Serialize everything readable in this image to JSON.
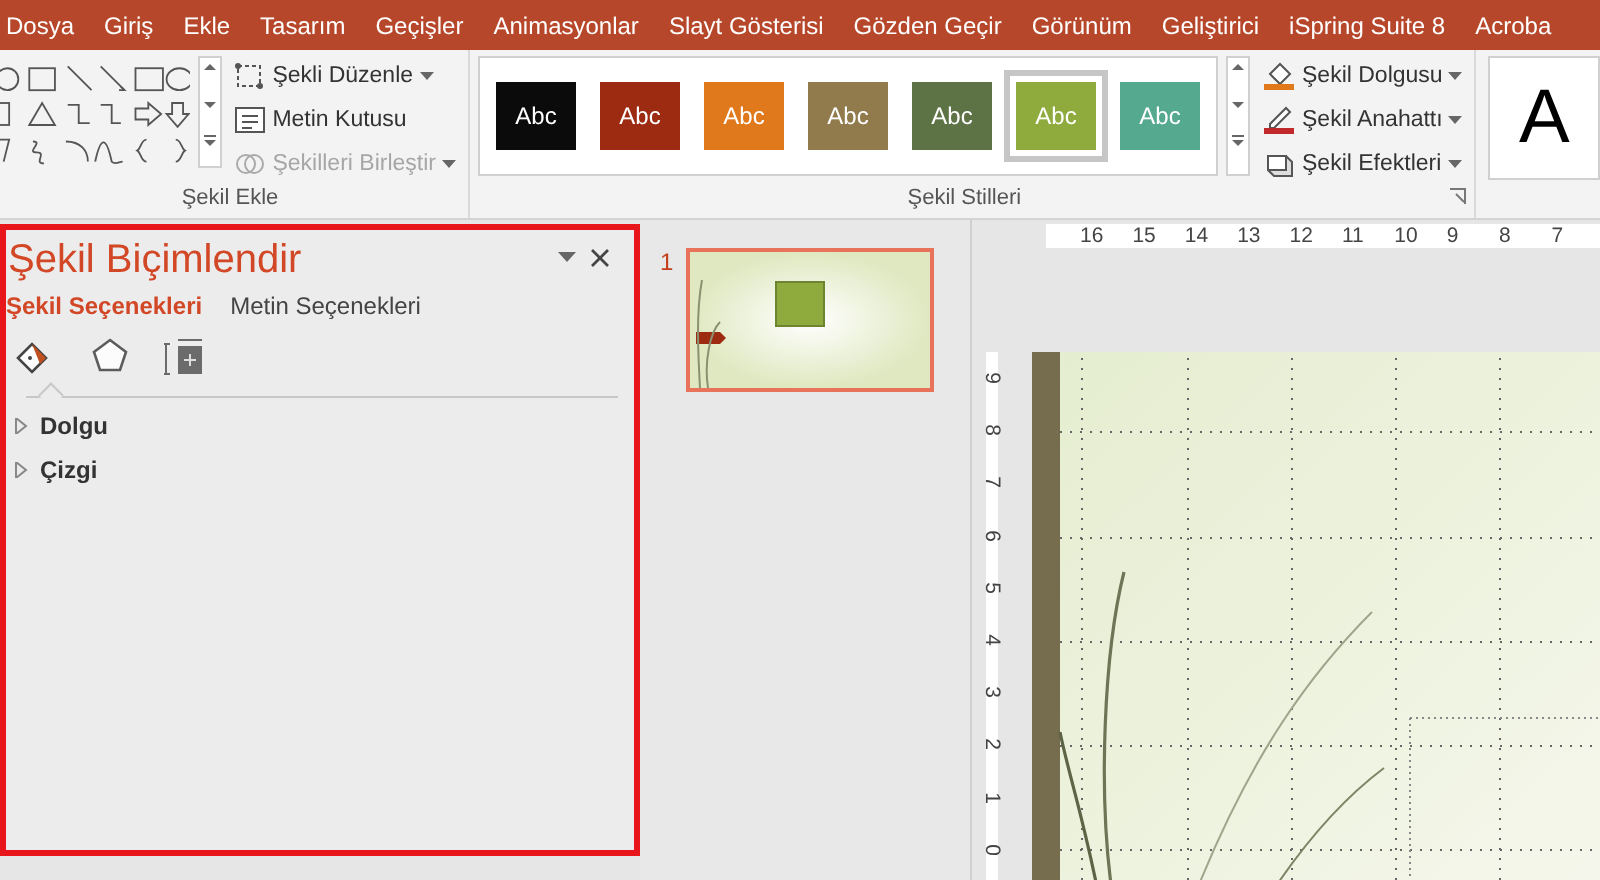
{
  "ribbon_tabs": [
    {
      "label": "Dosya"
    },
    {
      "label": "Giriş"
    },
    {
      "label": "Ekle"
    },
    {
      "label": "Tasarım"
    },
    {
      "label": "Geçişler"
    },
    {
      "label": "Animasyonlar"
    },
    {
      "label": "Slayt Gösterisi"
    },
    {
      "label": "Gözden Geçir"
    },
    {
      "label": "Görünüm"
    },
    {
      "label": "Geliştirici"
    },
    {
      "label": "iSpring Suite 8"
    },
    {
      "label": "Acroba"
    }
  ],
  "ribbon": {
    "insert_shapes": {
      "label": "Şekil Ekle",
      "commands": [
        {
          "kind": "edit",
          "label": "Şekli Düzenle",
          "dropdown": true,
          "disabled": false
        },
        {
          "kind": "textbox",
          "label": "Metin Kutusu",
          "dropdown": false,
          "disabled": false
        },
        {
          "kind": "merge",
          "label": "Şekilleri Birleştir",
          "dropdown": true,
          "disabled": true
        }
      ]
    },
    "shape_styles": {
      "label": "Şekil Stilleri",
      "styles": [
        {
          "label": "Abc",
          "color": "#0b0b0b",
          "selected": false
        },
        {
          "label": "Abc",
          "color": "#9c2b12",
          "selected": false
        },
        {
          "label": "Abc",
          "color": "#e0781c",
          "selected": false
        },
        {
          "label": "Abc",
          "color": "#917b4c",
          "selected": false
        },
        {
          "label": "Abc",
          "color": "#5e7345",
          "selected": false
        },
        {
          "label": "Abc",
          "color": "#90ab3d",
          "selected": true
        },
        {
          "label": "Abc",
          "color": "#55a98f",
          "selected": false
        }
      ],
      "commands": [
        {
          "kind": "fill",
          "label": "Şekil Dolgusu"
        },
        {
          "kind": "outline",
          "label": "Şekil Anahattı"
        },
        {
          "kind": "effects",
          "label": "Şekil Efektleri"
        }
      ]
    },
    "wordart": {
      "label": "A"
    }
  },
  "format_pane": {
    "title": "Şekil Biçimlendir",
    "tabs": [
      {
        "label": "Şekil Seçenekleri",
        "selected": true
      },
      {
        "label": "Metin Seçenekleri",
        "selected": false
      }
    ],
    "icon_tabs": [
      {
        "kind": "fill",
        "selected": true
      },
      {
        "kind": "shape",
        "selected": false
      },
      {
        "kind": "size",
        "selected": false
      }
    ],
    "sections": [
      {
        "label": "Dolgu",
        "expanded": false
      },
      {
        "label": "Çizgi",
        "expanded": false
      }
    ]
  },
  "slides": [
    {
      "number": "1",
      "selected": true
    }
  ],
  "rulers": {
    "horizontal": [
      "16",
      "15",
      "14",
      "13",
      "12",
      "11",
      "10",
      "9",
      "8",
      "7"
    ],
    "vertical": [
      "9",
      "8",
      "7",
      "6",
      "5",
      "4",
      "3",
      "2",
      "1",
      "0"
    ]
  }
}
